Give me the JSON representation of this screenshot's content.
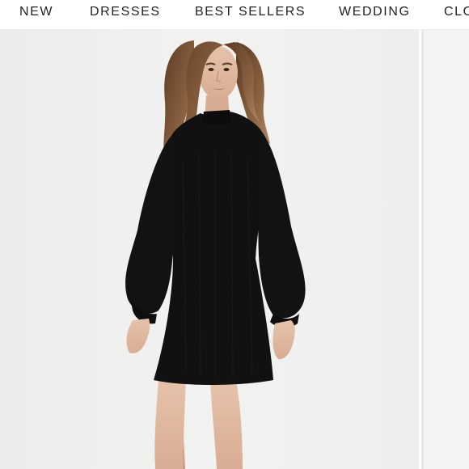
{
  "nav": {
    "items": [
      {
        "label": "NEW"
      },
      {
        "label": "DRESSES"
      },
      {
        "label": "BEST SELLERS"
      },
      {
        "label": "WEDDING"
      },
      {
        "label": "CLO"
      }
    ]
  },
  "product_image": {
    "icon": "model-in-black-dress-photo"
  },
  "colors": {
    "dress": "#111111",
    "background": "#efefee",
    "skin": "#e2bba3",
    "hair": "#7a5436"
  }
}
